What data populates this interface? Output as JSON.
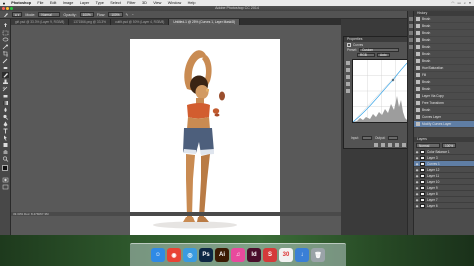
{
  "menubar": {
    "apple": "",
    "items": [
      "Photoshop",
      "File",
      "Edit",
      "Image",
      "Layer",
      "Type",
      "Select",
      "Filter",
      "3D",
      "View",
      "Window",
      "Help"
    ],
    "right": [
      "",
      "",
      "",
      ""
    ]
  },
  "window": {
    "title": "Adobe Photoshop CC 2014"
  },
  "options": {
    "mode_label": "Mode:",
    "mode_value": "Normal",
    "opacity_label": "Opacity:",
    "opacity_value": "100%",
    "flow_label": "Flow:",
    "flow_value": "100%"
  },
  "tabs": [
    {
      "label": "girl.psd @ 33.3% (Layer 9, RGB/8)",
      "active": false
    },
    {
      "label": "1371566.png @ 33.3%",
      "active": false
    },
    {
      "label": "outfit.psd @ 50% (Layer 4, RGB/8)",
      "active": false
    },
    {
      "label": "Untitled-1 @ 25% (Curves 1, Layer Mask/8)",
      "active": true
    }
  ],
  "status": {
    "text": "33.33%   Doc: 8.47M/67.3M"
  },
  "properties": {
    "title": "Properties",
    "subtitle": "Curves",
    "preset_label": "Preset:",
    "preset_value": "Custom",
    "channel_value": "RGB",
    "auto_label": "Auto",
    "input_label": "Input:",
    "output_label": "Output:"
  },
  "history": {
    "title": "History",
    "items": [
      "Brush",
      "Brush",
      "Brush",
      "Brush",
      "Brush",
      "Brush",
      "Brush",
      "Hue/Saturation",
      "Fill",
      "Brush",
      "Brush",
      "Layer Via Copy",
      "Free Transform",
      "Brush",
      "Curves Layer",
      "Modify Curves Layer"
    ],
    "selected_index": 15
  },
  "layers": {
    "title": "Layers",
    "blend": "Normal",
    "opacity": "100%",
    "rows": [
      {
        "name": "Color Balance 1",
        "selected": false
      },
      {
        "name": "Layer 3",
        "selected": false
      },
      {
        "name": "Curves 1",
        "selected": true
      },
      {
        "name": "Layer 12",
        "selected": false
      },
      {
        "name": "Layer 11",
        "selected": false
      },
      {
        "name": "Layer 10",
        "selected": false
      },
      {
        "name": "Layer 9",
        "selected": false
      },
      {
        "name": "Layer 8",
        "selected": false
      },
      {
        "name": "Layer 7",
        "selected": false
      },
      {
        "name": "Layer 6",
        "selected": false
      }
    ]
  },
  "dock": {
    "apps": [
      {
        "name": "Finder",
        "glyph": "☺",
        "color": "#2f8ae6"
      },
      {
        "name": "Chrome",
        "glyph": "◉",
        "color": "#e94335"
      },
      {
        "name": "Safari",
        "glyph": "◎",
        "color": "#3a9be0"
      },
      {
        "name": "Photoshop",
        "glyph": "Ps",
        "color": "#0d2744"
      },
      {
        "name": "Illustrator",
        "glyph": "Ai",
        "color": "#3b1a03"
      },
      {
        "name": "iTunes",
        "glyph": "♫",
        "color": "#e84a9d"
      },
      {
        "name": "InDesign",
        "glyph": "Id",
        "color": "#4a0d2b"
      },
      {
        "name": "Sketch",
        "glyph": "S",
        "color": "#d43a3a"
      },
      {
        "name": "Calendar",
        "glyph": "30",
        "color": "#f2f2f2"
      },
      {
        "name": "Downloads",
        "glyph": "↓",
        "color": "#3a7fd6"
      },
      {
        "name": "Trash",
        "glyph": "🗑",
        "color": "#9aa3a8"
      }
    ]
  }
}
